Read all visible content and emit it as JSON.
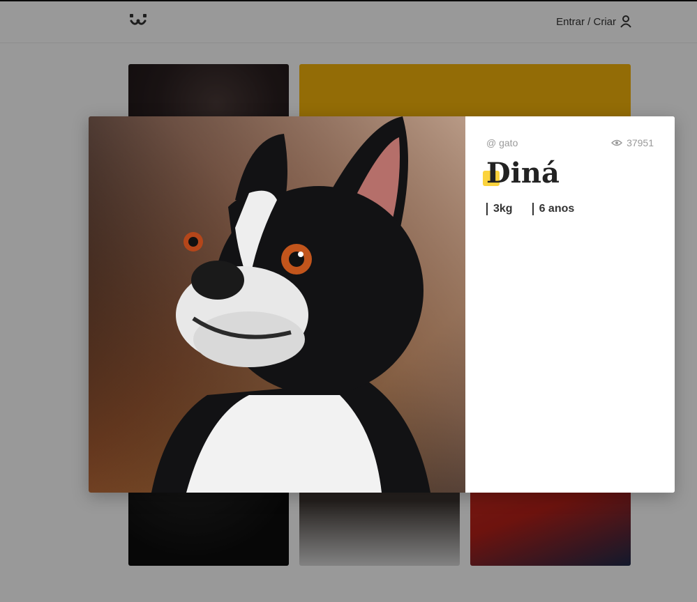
{
  "header": {
    "logo_icon": "dog-face-icon",
    "login_label": "Entrar / Criar",
    "login_icon": "user-icon"
  },
  "photo": {
    "author": "@ gato",
    "views": "37951",
    "views_icon": "eye-icon",
    "name": "Diná",
    "weight": "3kg",
    "age": "6 anos"
  },
  "colors": {
    "accent": "#fbd33d",
    "title": "#222222",
    "muted": "#999999"
  }
}
